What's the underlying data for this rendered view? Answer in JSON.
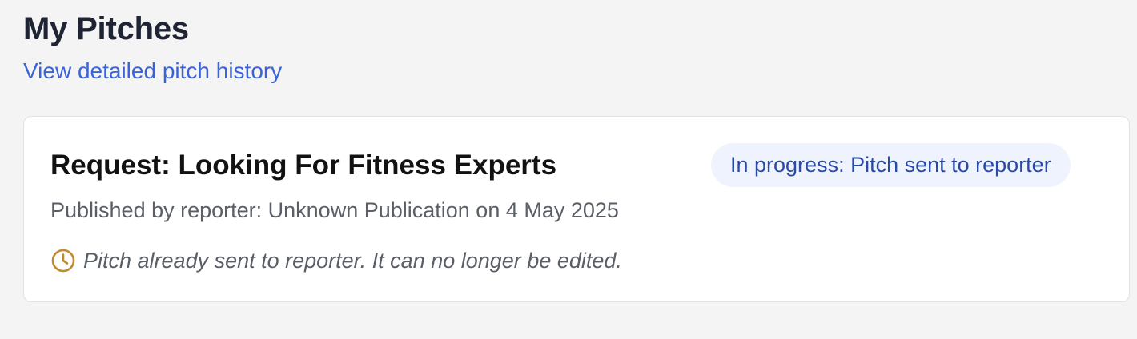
{
  "header": {
    "title": "My Pitches",
    "history_link": "View detailed pitch history"
  },
  "pitch": {
    "title": "Request: Looking For Fitness Experts",
    "status": "In progress: Pitch sent to reporter",
    "byline": "Published by reporter: Unknown Publication on 4 May 2025",
    "notice": "Pitch already sent to reporter. It can no longer be edited.",
    "notice_icon": "clock-icon"
  },
  "colors": {
    "page_background": "#f4f4f4",
    "link": "#3a63d8",
    "status_badge_bg": "#eef3fd",
    "status_badge_text": "#2a4aa8",
    "clock_icon": "#c08a2d"
  }
}
